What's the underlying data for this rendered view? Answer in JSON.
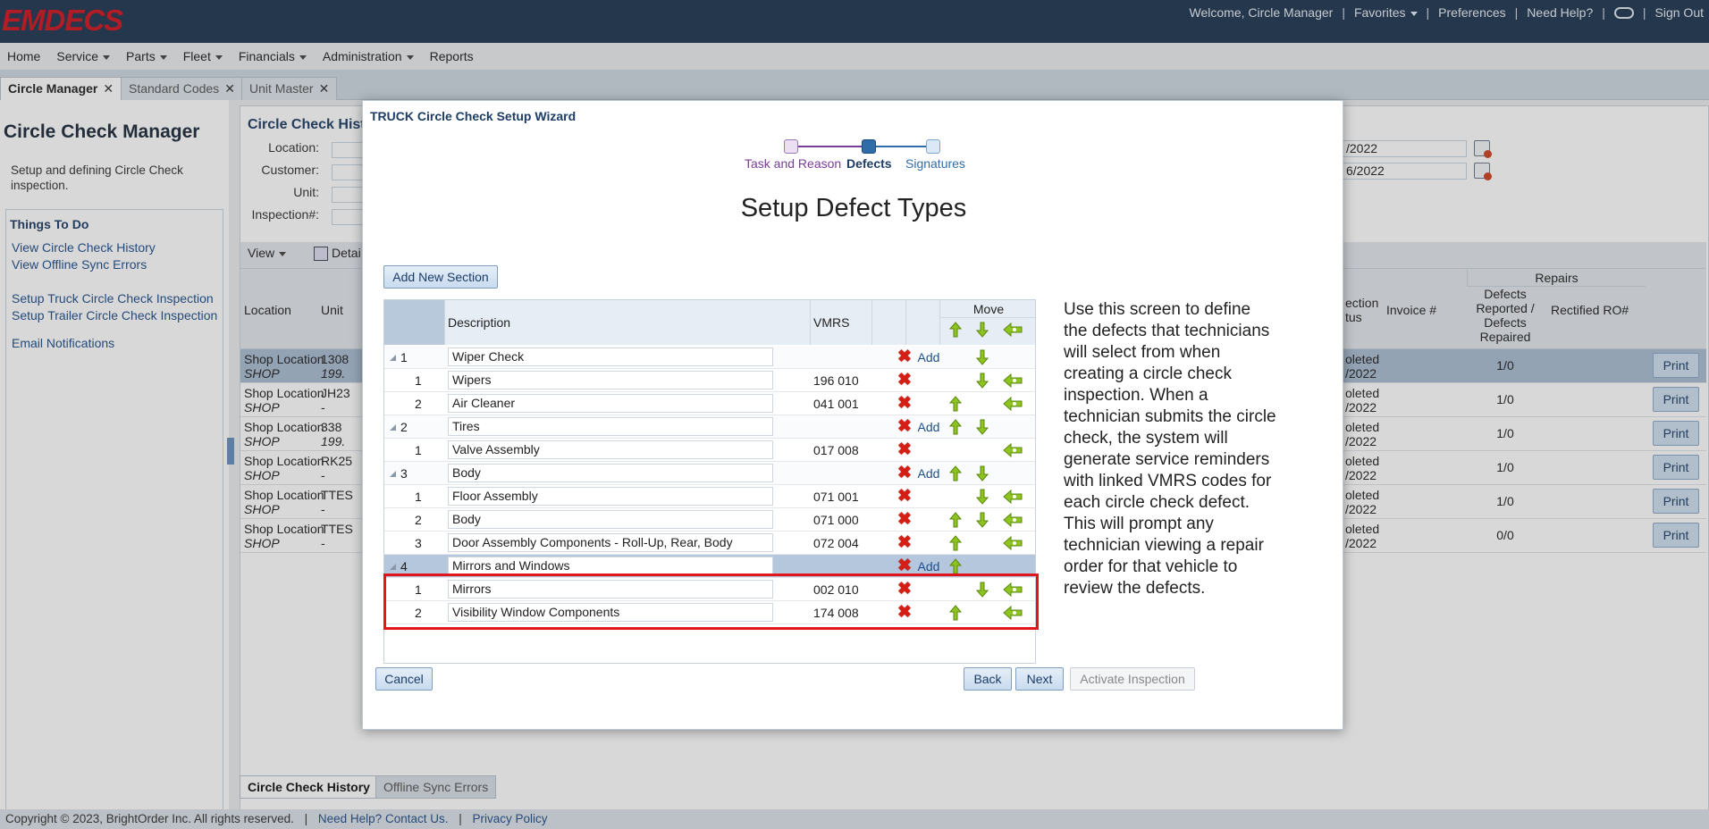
{
  "header": {
    "logo": "EMDECS",
    "welcome": "Welcome, Circle Manager",
    "favorites": "Favorites",
    "preferences": "Preferences",
    "help": "Need Help?",
    "signout": "Sign Out"
  },
  "nav": [
    "Home",
    "Service",
    "Parts",
    "Fleet",
    "Financials",
    "Administration",
    "Reports"
  ],
  "tabs": [
    "Circle Manager",
    "Standard Codes",
    "Unit Master"
  ],
  "left": {
    "title": "Circle Check Manager",
    "desc": "Setup and defining Circle Check inspection.",
    "todo_title": "Things To Do",
    "links": [
      "View Circle Check History",
      "View Offline Sync Errors",
      "Setup Truck Circle Check Inspection",
      "Setup Trailer Circle Check Inspection",
      "Email Notifications"
    ]
  },
  "main": {
    "title": "Circle Check Histo",
    "labels": [
      "Location:",
      "Customer:",
      "Unit:",
      "Inspection#:"
    ],
    "date1": "/2022",
    "date2": "6/2022",
    "view": "View",
    "detail": "Detai",
    "headers": {
      "location": "Location",
      "unit": "Unit",
      "status1": "ection",
      "status2": "tus",
      "invoice": "Invoice #",
      "repairs": "Repairs",
      "defects": "Defects Reported / Defects Repaired",
      "rectified": "Rectified RO#"
    },
    "rows": [
      {
        "loc": "Shop Location",
        "sub": "SHOP",
        "unit": "1308",
        "unit2": "199.",
        "st1": "oleted",
        "st2": "/2022",
        "ratio": "1/0",
        "print": "Print"
      },
      {
        "loc": "Shop Location",
        "sub": "SHOP",
        "unit": "JH23",
        "unit2": "-",
        "st1": "oleted",
        "st2": "/2022",
        "ratio": "1/0",
        "print": "Print"
      },
      {
        "loc": "Shop Location",
        "sub": "SHOP",
        "unit": "338",
        "unit2": "199.",
        "st1": "oleted",
        "st2": "/2022",
        "ratio": "1/0",
        "print": "Print"
      },
      {
        "loc": "Shop Location",
        "sub": "SHOP",
        "unit": "RK25",
        "unit2": "-",
        "st1": "oleted",
        "st2": "/2022",
        "ratio": "1/0",
        "print": "Print"
      },
      {
        "loc": "Shop Location",
        "sub": "SHOP",
        "unit": "TTES",
        "unit2": "-",
        "st1": "oleted",
        "st2": "/2022",
        "ratio": "1/0",
        "print": "Print"
      },
      {
        "loc": "Shop Location",
        "sub": "SHOP",
        "unit": "TTES",
        "unit2": "-",
        "st1": "oleted",
        "st2": "/2022",
        "ratio": "0/0",
        "print": "Print"
      }
    ],
    "bottom_tabs": [
      "Circle Check History",
      "Offline Sync Errors"
    ]
  },
  "footer": {
    "copyright": "Copyright © 2023, BrightOrder Inc. All rights reserved.",
    "contact": "Need Help? Contact Us.",
    "privacy": "Privacy Policy"
  },
  "dialog": {
    "title": "TRUCK Circle Check Setup Wizard",
    "steps": [
      "Task and Reason",
      "Defects",
      "Signatures"
    ],
    "heading": "Setup Defect Types",
    "add_section": "Add New Section",
    "col_description": "Description",
    "col_vmrs": "VMRS",
    "col_move": "Move",
    "add_label": "Add",
    "rows": [
      {
        "num": "1",
        "desc": "Wiper Check",
        "vmrs": "",
        "type": "section",
        "add": true,
        "up": false,
        "down": true,
        "mv": false
      },
      {
        "num": "1",
        "desc": "Wipers",
        "vmrs": "196 010",
        "type": "item",
        "add": false,
        "up": false,
        "down": true,
        "mv": true
      },
      {
        "num": "2",
        "desc": "Air Cleaner",
        "vmrs": "041 001",
        "type": "item",
        "add": false,
        "up": true,
        "down": false,
        "mv": true
      },
      {
        "num": "2",
        "desc": "Tires",
        "vmrs": "",
        "type": "section",
        "add": true,
        "up": true,
        "down": true,
        "mv": false
      },
      {
        "num": "1",
        "desc": "Valve Assembly",
        "vmrs": "017 008",
        "type": "item",
        "add": false,
        "up": false,
        "down": false,
        "mv": true
      },
      {
        "num": "3",
        "desc": "Body",
        "vmrs": "",
        "type": "section",
        "add": true,
        "up": true,
        "down": true,
        "mv": false
      },
      {
        "num": "1",
        "desc": "Floor Assembly",
        "vmrs": "071 001",
        "type": "item",
        "add": false,
        "up": false,
        "down": true,
        "mv": true
      },
      {
        "num": "2",
        "desc": "Body",
        "vmrs": "071 000",
        "type": "item",
        "add": false,
        "up": true,
        "down": true,
        "mv": true
      },
      {
        "num": "3",
        "desc": "Door Assembly Components - Roll-Up, Rear, Body",
        "vmrs": "072 004",
        "type": "item",
        "add": false,
        "up": true,
        "down": false,
        "mv": true
      },
      {
        "num": "4",
        "desc": "Mirrors and Windows",
        "vmrs": "",
        "type": "section-selected",
        "add": true,
        "up": true,
        "down": false,
        "mv": false
      },
      {
        "num": "1",
        "desc": "Mirrors",
        "vmrs": "002 010",
        "type": "item",
        "add": false,
        "up": false,
        "down": true,
        "mv": true
      },
      {
        "num": "2",
        "desc": "Visibility Window Components",
        "vmrs": "174 008",
        "type": "item",
        "add": false,
        "up": true,
        "down": false,
        "mv": true
      }
    ],
    "help_text": "Use this screen to define the defects that technicians will select from when creating a circle check inspection. When a technician submits the circle check, the system will generate service reminders with linked VMRS codes for each circle check defect. This will prompt any technician viewing a repair order for that vehicle to review the defects.",
    "cancel": "Cancel",
    "back": "Back",
    "next": "Next",
    "activate": "Activate Inspection"
  },
  "colors": {
    "brand": "#d0141e",
    "header_bg": "#1f3650",
    "highlight": "#e0161c",
    "delete": "#d51e14",
    "arrow": "#8fc31f"
  }
}
